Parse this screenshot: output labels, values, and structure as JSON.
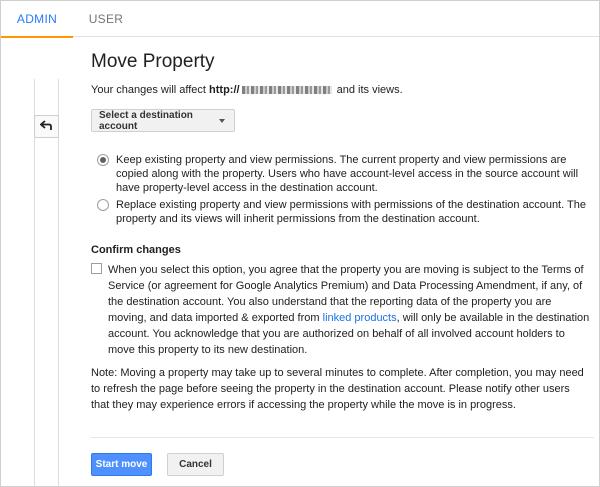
{
  "tabs": [
    {
      "label": "ADMIN",
      "active": true
    },
    {
      "label": "USER",
      "active": false
    }
  ],
  "accent_color": "#2979ff",
  "tab_indicator_color": "#ff9800",
  "page": {
    "title": "Move Property",
    "affect_prefix": "Your changes will affect ",
    "affect_url_visible": "http://",
    "affect_suffix": " and its views."
  },
  "destination_select": {
    "label": "Select a destination account"
  },
  "permission_options": [
    {
      "selected": true,
      "text": "Keep existing property and view permissions. The current property and view permissions are copied along with the property. Users who have account-level access in the source account will have property-level access in the destination account."
    },
    {
      "selected": false,
      "text": "Replace existing property and view permissions with permissions of the destination account. The property and its views will inherit permissions from the destination account."
    }
  ],
  "confirm": {
    "heading": "Confirm changes",
    "checked": false,
    "text_before_link": "When you select this option, you agree that the property you are moving is subject to the Terms of Service (or agreement for Google Analytics Premium) and Data Processing Amendment, if any, of the destination account. You also understand that the reporting data of the property you are moving, and data imported & exported from ",
    "link_text": "linked products",
    "text_after_link": ", will only be available in the destination account. You acknowledge that you are authorized on behalf of all involved account holders to move this property to its new destination."
  },
  "note": "Note: Moving a property may take up to several minutes to complete. After completion, you may need to refresh the page before seeing the property in the destination account. Please notify other users that they may experience errors if accessing the property while the move is in progress.",
  "buttons": {
    "start": "Start move",
    "cancel": "Cancel"
  },
  "icons": {
    "back": "back-arrow-icon",
    "dropdown": "caret-down-icon"
  }
}
